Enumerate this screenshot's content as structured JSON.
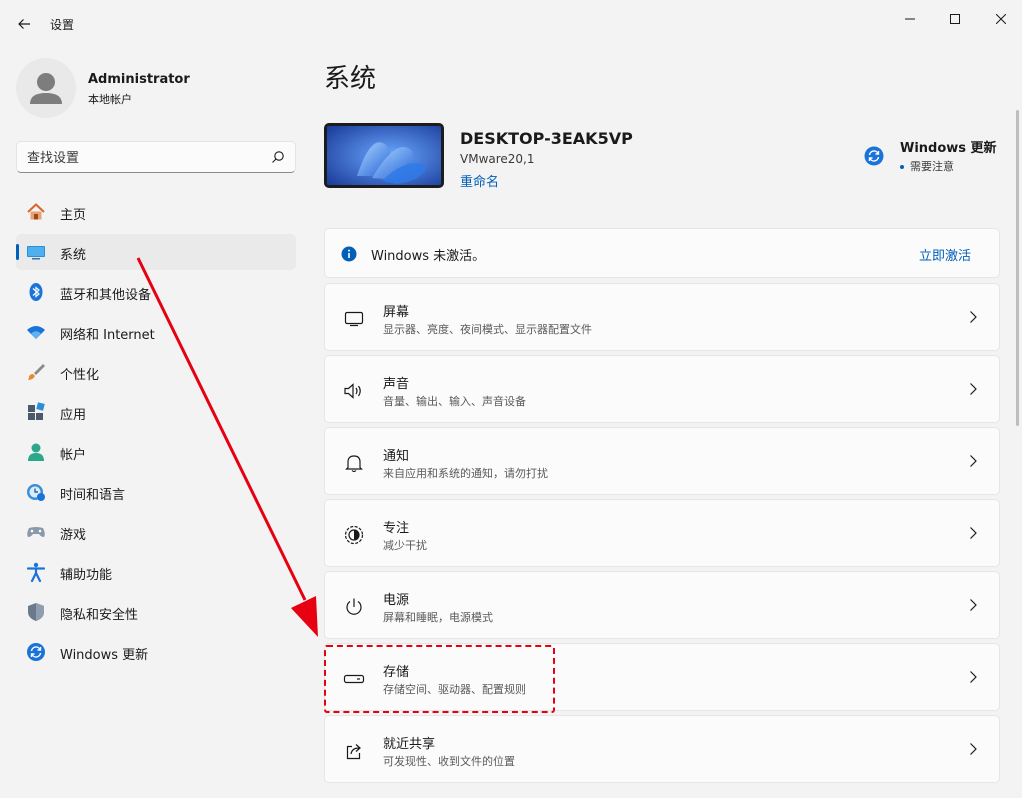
{
  "window": {
    "title": "设置"
  },
  "profile": {
    "name": "Administrator",
    "account_type": "本地帐户"
  },
  "search": {
    "placeholder": "查找设置"
  },
  "sidebar": {
    "items": [
      {
        "label": "主页",
        "icon": "home-icon",
        "active": false
      },
      {
        "label": "系统",
        "icon": "system-icon",
        "active": true
      },
      {
        "label": "蓝牙和其他设备",
        "icon": "bluetooth-icon",
        "active": false
      },
      {
        "label": "网络和 Internet",
        "icon": "wifi-icon",
        "active": false
      },
      {
        "label": "个性化",
        "icon": "brush-icon",
        "active": false
      },
      {
        "label": "应用",
        "icon": "apps-icon",
        "active": false
      },
      {
        "label": "帐户",
        "icon": "account-icon",
        "active": false
      },
      {
        "label": "时间和语言",
        "icon": "time-language-icon",
        "active": false
      },
      {
        "label": "游戏",
        "icon": "gamepad-icon",
        "active": false
      },
      {
        "label": "辅助功能",
        "icon": "accessibility-icon",
        "active": false
      },
      {
        "label": "隐私和安全性",
        "icon": "shield-icon",
        "active": false
      },
      {
        "label": "Windows 更新",
        "icon": "update-icon",
        "active": false
      }
    ]
  },
  "main": {
    "title": "系统",
    "device": {
      "name": "DESKTOP-3EAK5VP",
      "model": "VMware20,1",
      "rename": "重命名"
    },
    "update": {
      "title": "Windows 更新",
      "status": "需要注意"
    },
    "activation": {
      "text": "Windows 未激活。",
      "action": "立即激活"
    },
    "rows": [
      {
        "title": "屏幕",
        "desc": "显示器、亮度、夜间模式、显示器配置文件",
        "icon": "display-icon"
      },
      {
        "title": "声音",
        "desc": "音量、输出、输入、声音设备",
        "icon": "speaker-icon"
      },
      {
        "title": "通知",
        "desc": "来自应用和系统的通知，请勿打扰",
        "icon": "bell-icon"
      },
      {
        "title": "专注",
        "desc": "减少干扰",
        "icon": "focus-icon"
      },
      {
        "title": "电源",
        "desc": "屏幕和睡眠，电源模式",
        "icon": "power-icon"
      },
      {
        "title": "存储",
        "desc": "存储空间、驱动器、配置规则",
        "icon": "storage-icon"
      },
      {
        "title": "就近共享",
        "desc": "可发现性、收到文件的位置",
        "icon": "share-icon"
      }
    ]
  },
  "colors": {
    "accent": "#005fb8",
    "annotation": "#e60012"
  }
}
